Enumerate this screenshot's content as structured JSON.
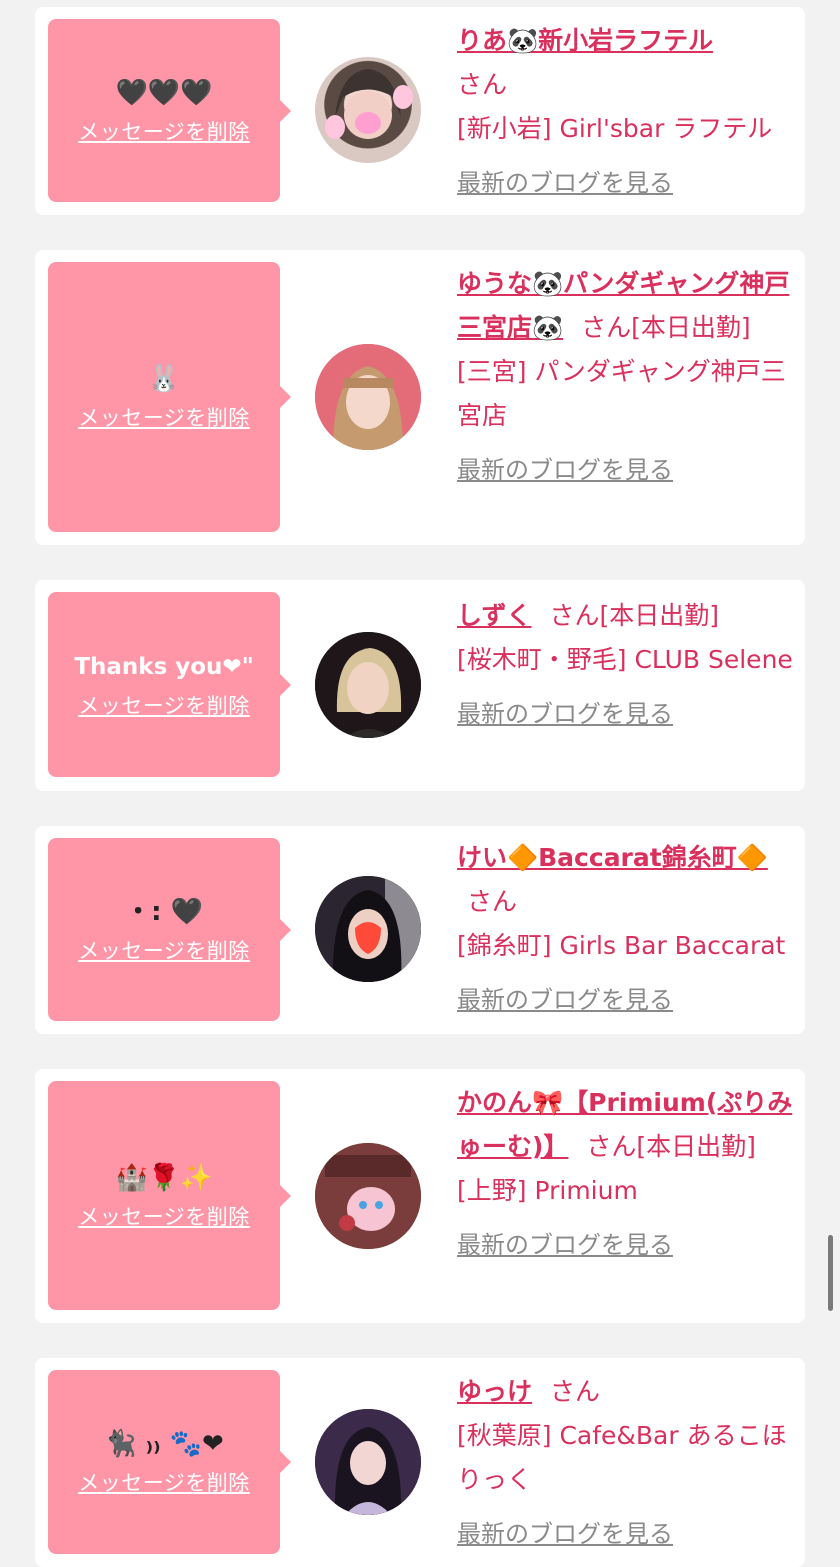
{
  "delete_label": "メッセージを削除",
  "blog_label": "最新のブログを見る",
  "honorific": "さん",
  "entries": [
    {
      "message": "🖤🖤🖤",
      "name": "りあ🐼新小岩ラフテル",
      "name_suffix": "",
      "shop": "[新小岩] Girl'sbar ラフテル"
    },
    {
      "message": "🐰",
      "name": "ゆうな🐼パンダギャング神戸三宮店🐼",
      "name_suffix": "[本日出勤]",
      "shop": "[三宮] パンダギャング神戸三宮店"
    },
    {
      "message": "Thanks you❤\"",
      "name": "しずく",
      "name_suffix": "[本日出勤]",
      "shop": "[桜木町・野毛] CLUB Selene"
    },
    {
      "message": "・: 🖤",
      "name": "けい🔶Baccarat錦糸町🔶",
      "name_suffix": "",
      "shop": "[錦糸町] Girls Bar Baccarat"
    },
    {
      "message": "🏰🌹✨",
      "name": "かのん🎀【Primium(ぷりみゅーむ)】",
      "name_suffix": "[本日出勤]",
      "shop": "[上野] Primium"
    },
    {
      "message": "🐈‍⬛ ₎₎ 🐾❤",
      "name": "ゆっけ",
      "name_suffix": "",
      "shop": "[秋葉原] Cafe&Bar あるこほりっく"
    }
  ]
}
